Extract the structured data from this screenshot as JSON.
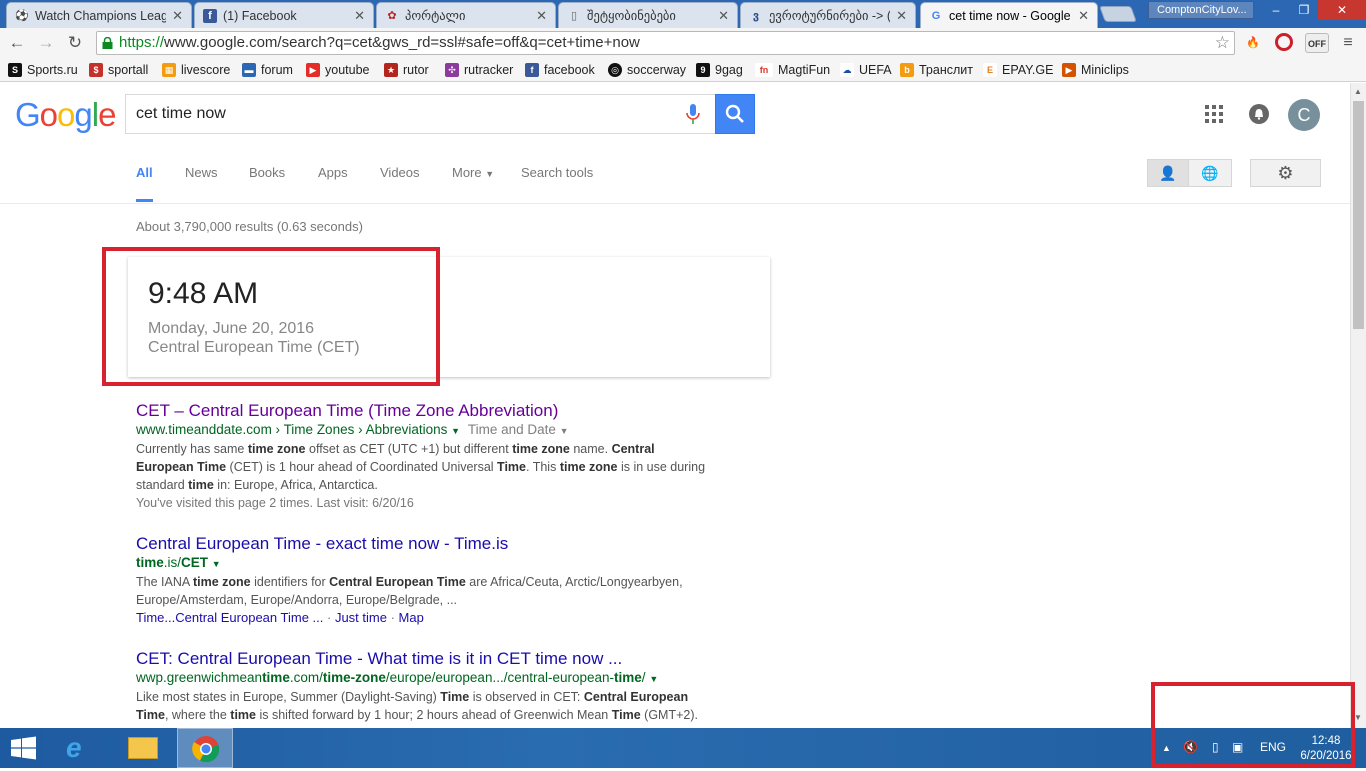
{
  "browser": {
    "tabs": [
      {
        "title": "Watch Champions Leag",
        "icon": "soccer-ball-icon"
      },
      {
        "title": "(1) Facebook",
        "icon": "facebook-icon"
      },
      {
        "title": "პორტალი",
        "icon": "portal-icon"
      },
      {
        "title": "შეტყობინებები",
        "icon": "page-icon"
      },
      {
        "title": "ევროტურნირები -> (",
        "icon": "forum-icon"
      },
      {
        "title": "cet time now - Google S",
        "icon": "google-icon",
        "active": true
      }
    ],
    "profile": "ComptonCityLov...",
    "url_scheme": "https://",
    "url_rest": "www.google.com/search?q=cet&gws_rd=ssl#safe=off&q=cet+time+now",
    "ext_off_label": "OFF",
    "bookmarks": [
      "Sports.ru",
      "sportall",
      "livescore",
      "forum",
      "youtube",
      "rutor",
      "rutracker",
      "facebook",
      "soccerway",
      "9gag",
      "MagtiFun",
      "UEFA",
      "Транслит",
      "EPAY.GE",
      "Miniclips"
    ]
  },
  "google": {
    "logo": "Google",
    "query": "cet time now",
    "avatar_letter": "C",
    "nav": [
      "All",
      "News",
      "Books",
      "Apps",
      "Videos",
      "More",
      "Search tools"
    ],
    "stats": "About 3,790,000 results (0.63 seconds)"
  },
  "time_card": {
    "time": "9:48 AM",
    "date": "Monday, June 20, 2016",
    "zone": "Central European Time (CET)"
  },
  "results": [
    {
      "title": "CET – Central European Time (Time Zone Abbreviation)",
      "url": "www.timeanddate.com › Time Zones › Abbreviations",
      "url_extra": "Time and Date",
      "snippet_lines": [
        "Currently has same time zone offset as CET (UTC +1) but different time zone name. Central",
        "European Time (CET) is 1 hour ahead of Coordinated Universal Time. This time zone is in use during",
        "standard time in: Europe, Africa, Antarctica."
      ],
      "visited": "You've visited this page 2 times. Last visit: 6/20/16"
    },
    {
      "title": "Central European Time - exact time now - Time.is",
      "url": "time.is/CET",
      "snippet_lines": [
        "The IANA time zone identifiers for Central European Time are Africa/Ceuta, Arctic/Longyearbyen,",
        "Europe/Amsterdam, Europe/Andorra, Europe/Belgrade, ..."
      ],
      "sublinks": [
        "Time...Central European Time ...",
        "Just time",
        "Map"
      ]
    },
    {
      "title": "CET: Central European Time - What time is it in CET time now ...",
      "url": "wwp.greenwichmeantime.com/time-zone/europe/european.../central-european-time/",
      "snippet_lines": [
        "Like most states in Europe, Summer (Daylight-Saving) Time is observed in CET: Central European",
        "Time, where the time is shifted forward by 1 hour; 2 hours ahead of Greenwich Mean Time (GMT+2)."
      ]
    }
  ],
  "taskbar": {
    "lang": "ENG",
    "clock_time": "12:48",
    "clock_date": "6/20/2016"
  }
}
